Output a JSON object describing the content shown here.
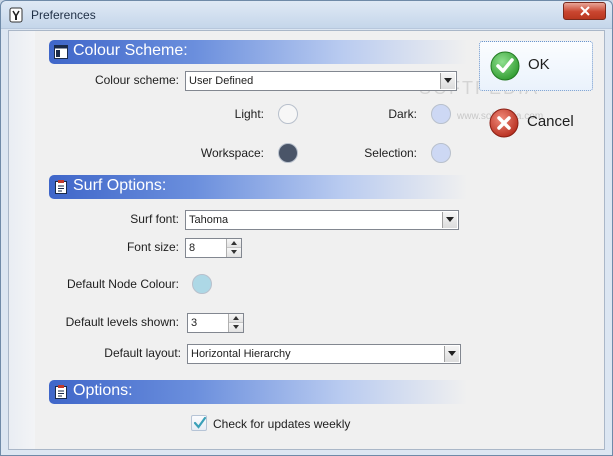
{
  "window": {
    "title": "Preferences"
  },
  "colour_scheme_section": {
    "header": "Colour Scheme:",
    "scheme_label": "Colour scheme:",
    "scheme_value": "User Defined",
    "light_label": "Light:",
    "light_color": "#f7f7f7",
    "dark_label": "Dark:",
    "dark_color": "#cdd8f4",
    "workspace_label": "Workspace:",
    "workspace_color": "#4a5568",
    "selection_label": "Selection:",
    "selection_color": "#cdd8f4"
  },
  "surf_section": {
    "header": "Surf Options:",
    "font_label": "Surf font:",
    "font_value": "Tahoma",
    "size_label": "Font size:",
    "size_value": "8",
    "node_colour_label": "Default Node Colour:",
    "node_colour": "#add8e6",
    "levels_label": "Default levels shown:",
    "levels_value": "3",
    "layout_label": "Default layout:",
    "layout_value": "Horizontal Hierarchy"
  },
  "options_section": {
    "header": "Options:",
    "updates_label": "Check for updates weekly",
    "updates_checked": true
  },
  "buttons": {
    "ok_label": "OK",
    "cancel_label": "Cancel"
  },
  "watermark": {
    "main": "SOFTPEDIA",
    "sub": "www.softpedia.com"
  },
  "colors": {
    "accent": "#3f66c9",
    "ok_green": "#3aa83a",
    "cancel_red": "#c0392b"
  }
}
